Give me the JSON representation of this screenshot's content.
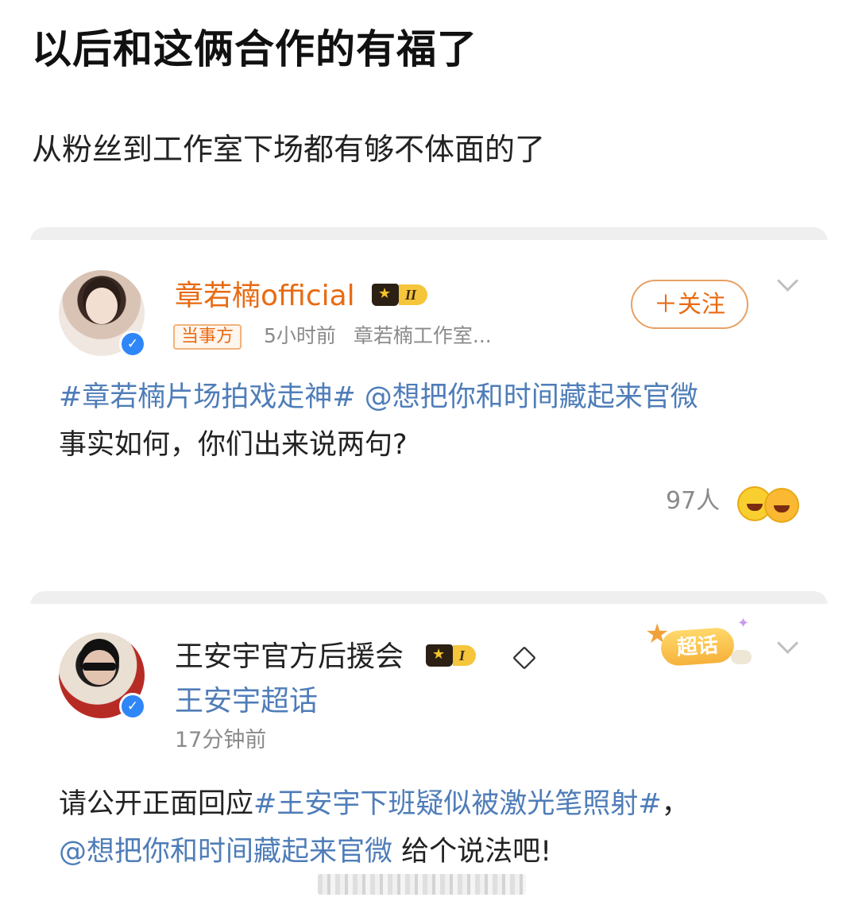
{
  "post": {
    "title": "以后和这俩合作的有福了",
    "body": "从粉丝到工作室下场都有够不体面的了"
  },
  "card1": {
    "username": "章若楠official",
    "crown_level": "II",
    "role_tag": "当事方",
    "time": "5小时前",
    "source": "章若楠工作室...",
    "follow_label": "＋关注",
    "text_line1_hashtag": "#章若楠片场拍戏走神#",
    "text_line1_mention": " @想把你和时间藏起来官微",
    "text_line2": "事实如何，你们出来说两句?",
    "likes": "97人"
  },
  "card2": {
    "username": "王安宇官方后援会",
    "crown_level": "I",
    "supertopic_badge": "超话",
    "supertopic_name": "王安宇超话",
    "time": "17分钟前",
    "text_line1_prefix": "请公开正面回应",
    "text_line1_hashtag": "#王安宇下班疑似被激光笔照射#",
    "text_line1_suffix": "，",
    "text_line2_mention": "@想把你和时间藏起来官微",
    "text_line2_suffix": " 给个说法吧!"
  },
  "icons": {
    "verified": "verified-icon",
    "crown": "crown-icon",
    "diamond": "diamond-icon",
    "chevron": "chevron-down-icon",
    "emoji": "laughing-emoji-icon"
  },
  "colors": {
    "accent_orange": "#e86b13",
    "link_blue": "#4f7db8",
    "verified_blue": "#2f86f6",
    "meta_gray": "#8a8a8a"
  }
}
